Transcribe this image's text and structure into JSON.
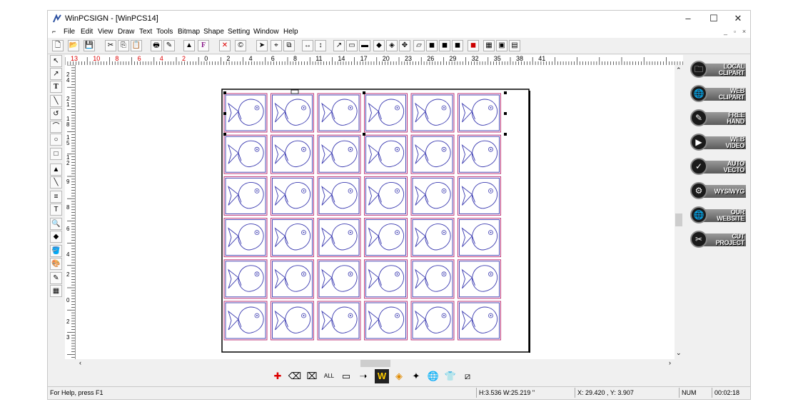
{
  "window": {
    "title": "WinPCSIGN - [WinPCS14]"
  },
  "menu": [
    "File",
    "Edit",
    "View",
    "Draw",
    "Text",
    "Tools",
    "Bitmap",
    "Shape",
    "Setting",
    "Window",
    "Help"
  ],
  "menu_underline": [
    "F",
    "E",
    "V",
    "D",
    "x",
    "T",
    "B",
    "p",
    "",
    "W",
    "H"
  ],
  "toolbar": {
    "icons": [
      "new-icon",
      "open-icon",
      "save-icon",
      "cut-icon",
      "copy-icon",
      "paste-icon",
      "print-icon",
      "cutter-icon",
      "pen-tool-icon",
      "font-icon",
      "delete-icon",
      "copyright-icon",
      "select-arrow-icon",
      "node-edit-icon",
      "weld-icon",
      "mirror-horizontal-icon",
      "mirror-vertical-icon",
      "arrange-icon-1",
      "arrange-icon-2",
      "arrange-icon-3",
      "arrange-icon-4",
      "arrange-icon-5",
      "arrange-icon-6",
      "arrange-icon-7",
      "arrange-icon-8",
      "arrange-icon-9",
      "arrange-icon-10",
      "arrange-icon-11",
      "group-icon-1",
      "group-icon-2",
      "group-icon-3"
    ]
  },
  "left_tools": [
    "pointer-tool-icon",
    "node-tool-icon",
    "text-tool-icon",
    "line-tool-icon",
    "curve-tool-icon",
    "bezier-tool-icon",
    "ellipse-tool-icon",
    "rectangle-tool-icon",
    "fill-tool-icon",
    "knife-tool-icon",
    "text-fit-icon",
    "vertical-text-icon",
    "zoom-tool-icon",
    "eraser-tool-icon",
    "paint-bucket-icon",
    "palette-icon",
    "measure-tool-icon",
    "calculator-icon"
  ],
  "ruler": {
    "h_labels": [
      "13",
      "10",
      "8",
      "6",
      "4",
      "2",
      "0",
      "2",
      "4",
      "6",
      "8",
      "11",
      "14",
      "17",
      "20",
      "23",
      "26",
      "29",
      "32",
      "35",
      "38",
      "41"
    ],
    "h_red_count": 6,
    "v_labels": [
      "2",
      "4",
      "2",
      "1",
      "1",
      "8",
      "1",
      "5",
      "1",
      "2",
      "9",
      "8",
      "6",
      "4",
      "2",
      "0",
      "2",
      "3"
    ]
  },
  "sheet": {
    "rows": 6,
    "cols": 6,
    "item": "fish"
  },
  "right_panel": [
    {
      "line1": "LOCAL",
      "line2": "CLIPART",
      "icon": "local-clipart-icon"
    },
    {
      "line1": "WEB",
      "line2": "CLIPART",
      "icon": "web-clipart-icon"
    },
    {
      "line1": "FREE",
      "line2": "HAND",
      "icon": "free-hand-icon"
    },
    {
      "line1": "WEB",
      "line2": "VIDEO",
      "icon": "web-video-icon"
    },
    {
      "line1": "AUTO",
      "line2": "VECTO",
      "icon": "auto-vecto-icon"
    },
    {
      "line1": "WYSIWYG",
      "line2": "",
      "icon": "wysiwyg-icon"
    },
    {
      "line1": "OUR",
      "line2": "WEBSITE",
      "icon": "our-website-icon"
    },
    {
      "line1": "CUT",
      "line2": "PROJECT",
      "icon": "cut-project-icon"
    }
  ],
  "bottom_tools": [
    "add-node-icon",
    "delete-node-icon",
    "break-node-icon",
    "all-nodes-icon",
    "to-line-icon",
    "to-curve-icon",
    "wysiwyg-w-icon",
    "contour-icon",
    "texture-icon",
    "globe-icon",
    "tshirt-icon",
    "crop-icon"
  ],
  "status": {
    "help": "For Help, press F1",
    "size": "H:3.536  W:25.219  \"",
    "coords": "X: 29.420 , Y: 3.907",
    "num": "NUM",
    "time": "00:02:18"
  }
}
